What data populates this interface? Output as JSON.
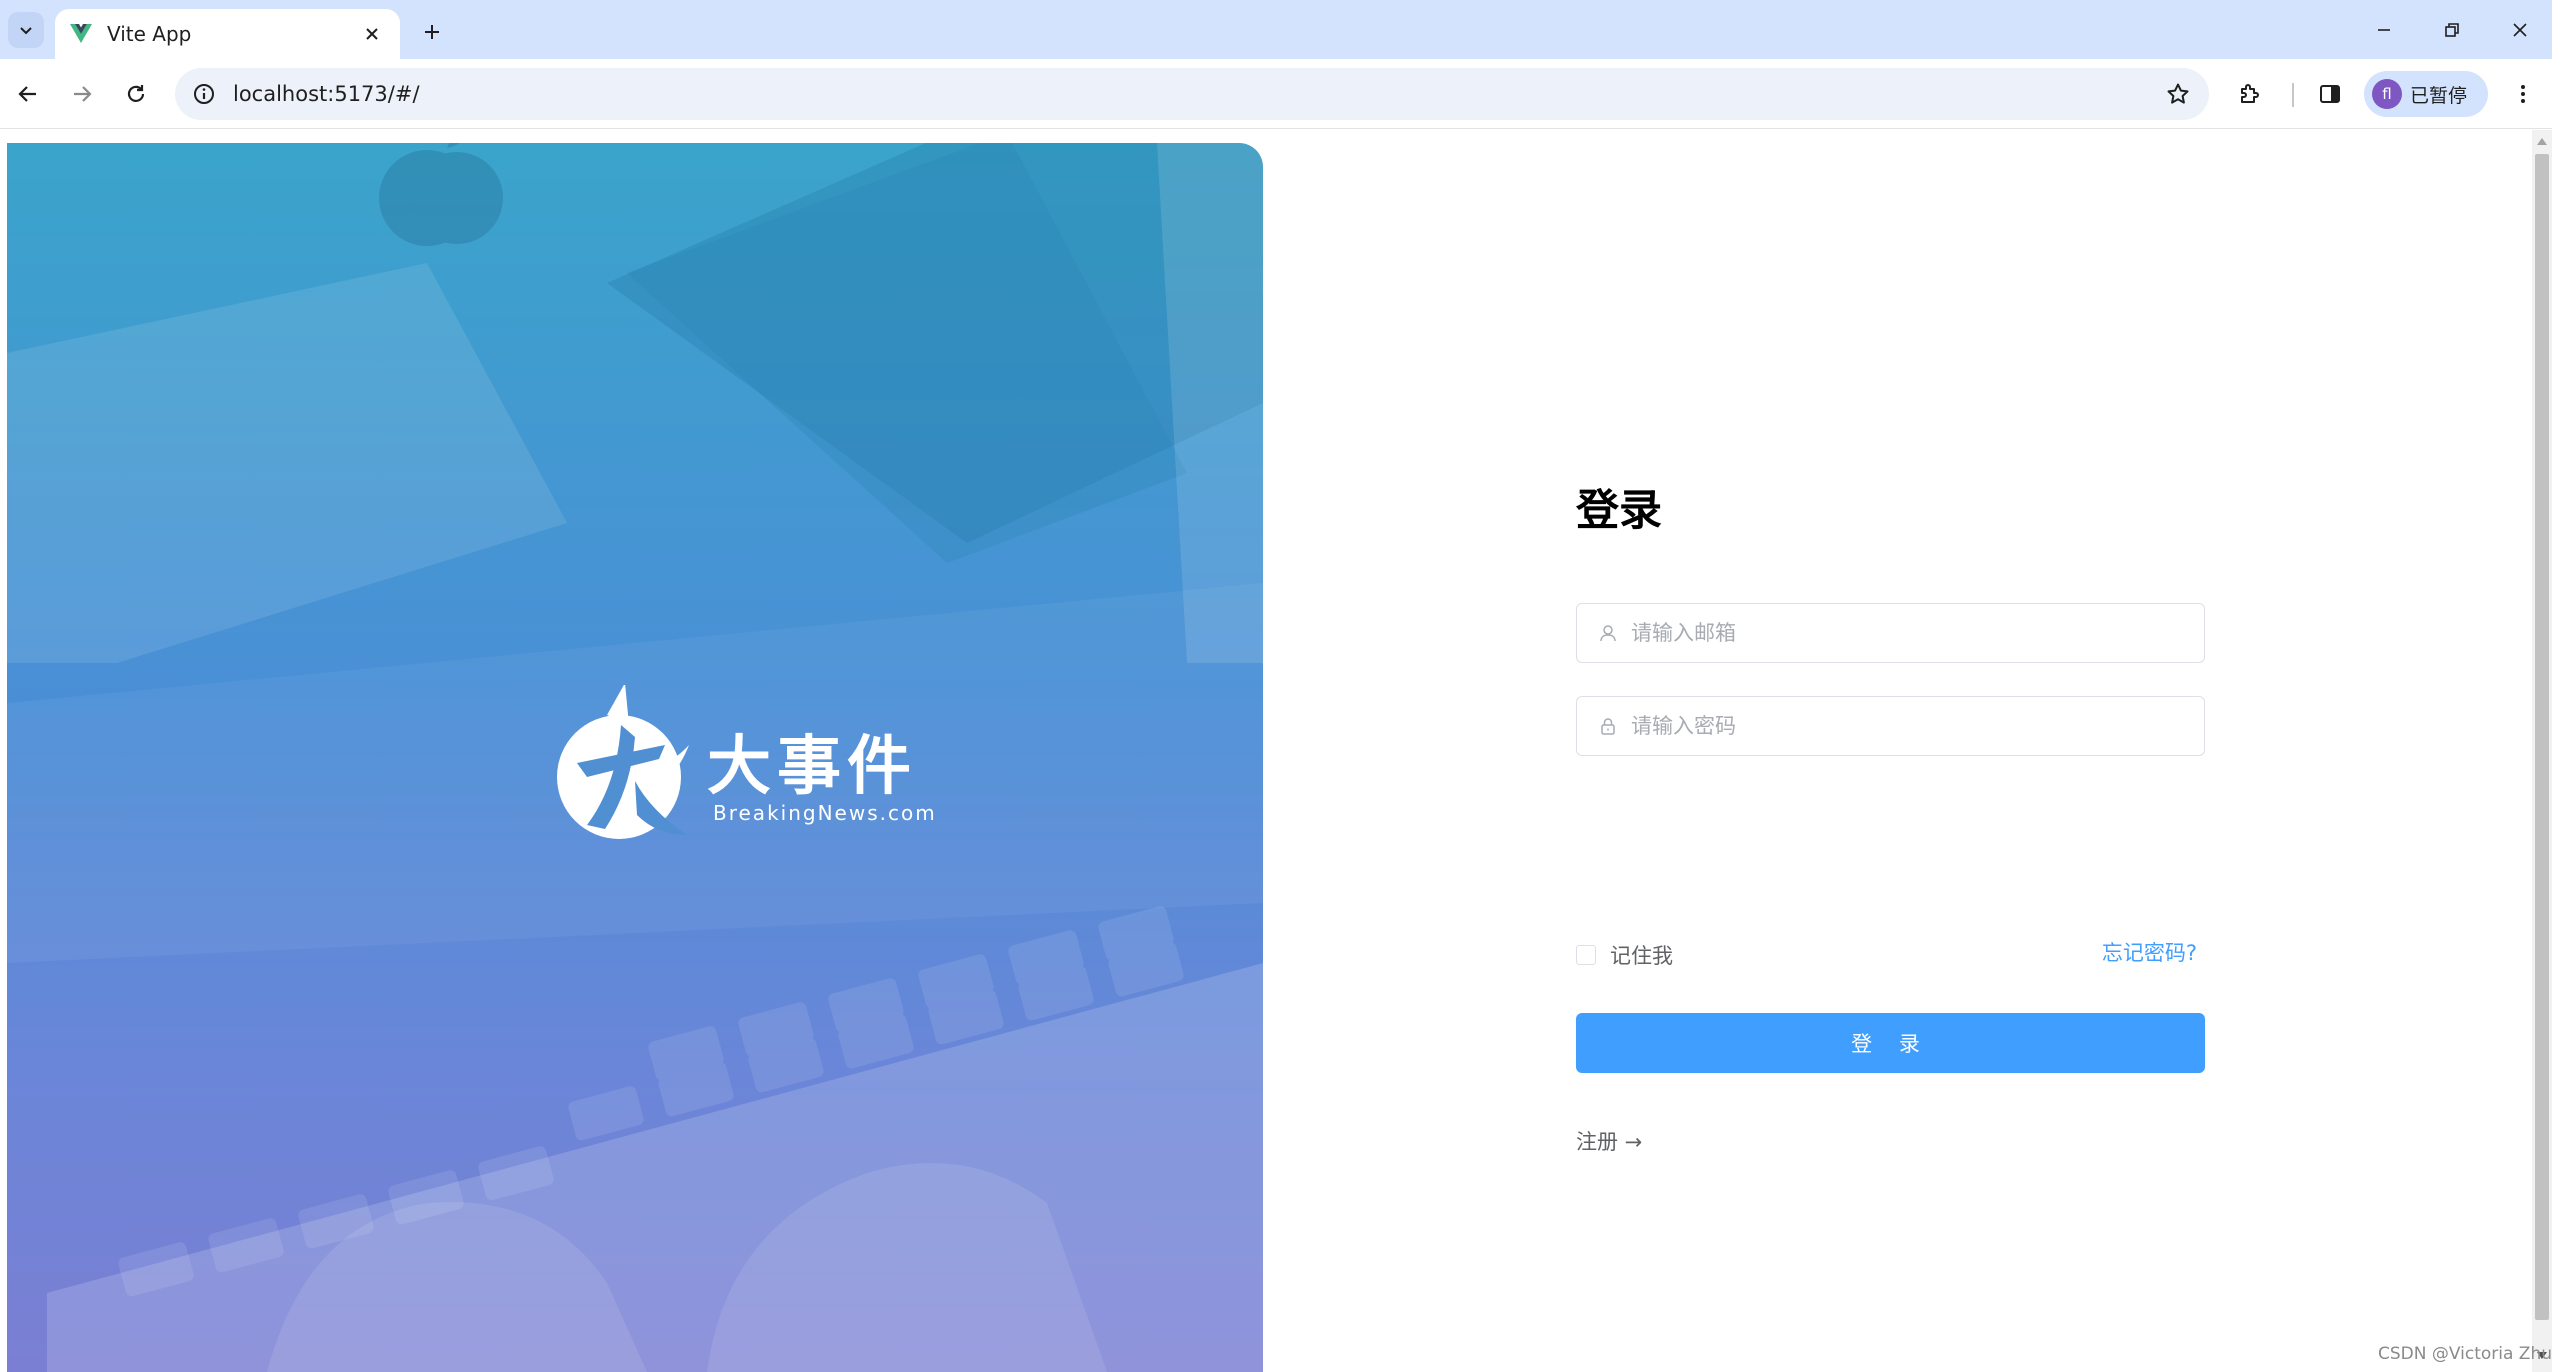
{
  "browser": {
    "tab_title": "Vite App",
    "url": "localhost:5173/#/",
    "profile_initial": "fl",
    "profile_status": "已暂停"
  },
  "hero": {
    "brand_name": "大事件",
    "brand_url": "BreakingNews.com"
  },
  "login": {
    "title": "登录",
    "email_placeholder": "请输入邮箱",
    "password_placeholder": "请输入密码",
    "remember_label": "记住我",
    "forgot_label": "忘记密码?",
    "submit_label": "登 录",
    "register_label": "注册 →"
  },
  "watermark": "CSDN @Victoria Zhu",
  "colors": {
    "primary": "#409eff",
    "tabstrip": "#d3e3fd",
    "hero_top": "#3aa4cb",
    "hero_bottom": "#7b7fd3"
  }
}
